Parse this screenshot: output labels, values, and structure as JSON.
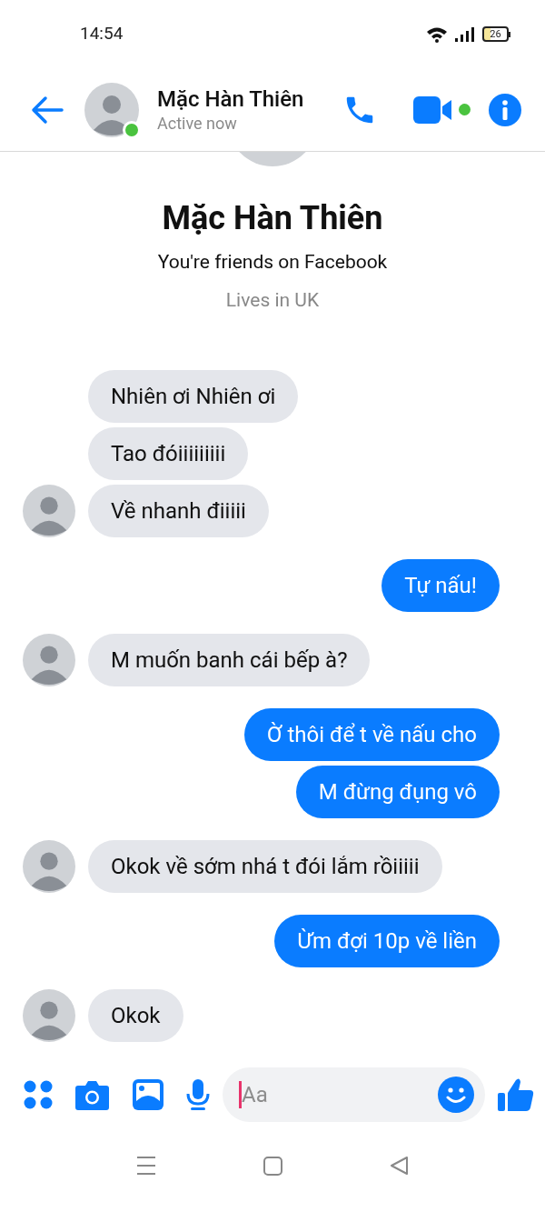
{
  "status_bar": {
    "time": "14:54",
    "battery": "26"
  },
  "header": {
    "name": "Mặc Hàn Thiên",
    "status": "Active now",
    "online": true
  },
  "profile": {
    "name": "Mặc Hàn Thiên",
    "subtitle": "You're friends on Facebook",
    "location": "Lives in UK"
  },
  "messages": [
    {
      "kind": "incoming",
      "text": "Nhiên ơi Nhiên ơi"
    },
    {
      "kind": "incoming",
      "text": "Tao đóiiiiiiiii"
    },
    {
      "kind": "incoming",
      "text": "Về nhanh điiiii"
    },
    {
      "kind": "outgoing",
      "text": "Tự nấu!"
    },
    {
      "kind": "incoming",
      "text": "M muốn banh cái bếp à?"
    },
    {
      "kind": "outgoing",
      "text": "Ờ thôi để t về nấu cho"
    },
    {
      "kind": "outgoing",
      "text": "M đừng đụng vô"
    },
    {
      "kind": "incoming",
      "text": "Okok về sớm nhá t đói lắm rồiiiii"
    },
    {
      "kind": "outgoing",
      "text": "Ừm đợi 10p về liền"
    },
    {
      "kind": "incoming",
      "text": "Okok"
    }
  ],
  "composer": {
    "placeholder": "Aa"
  }
}
